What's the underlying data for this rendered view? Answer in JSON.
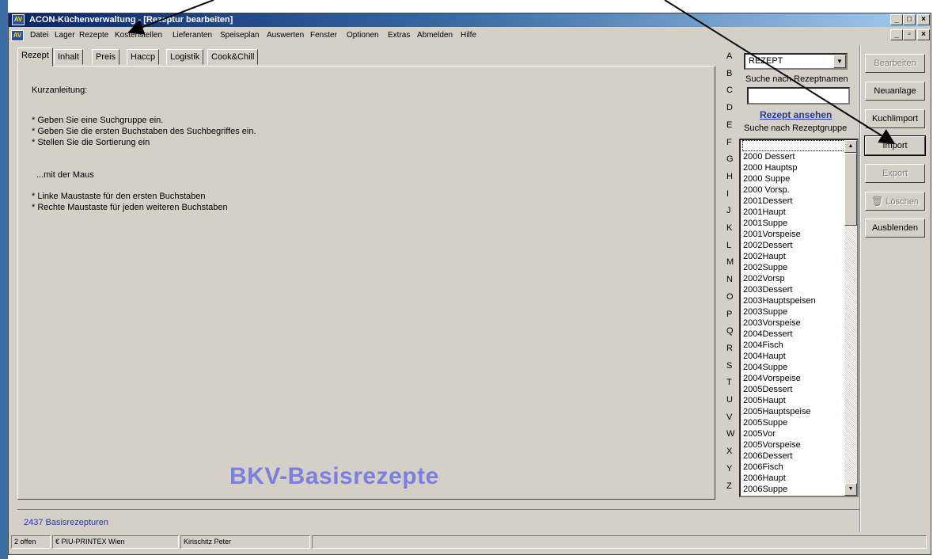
{
  "window": {
    "title": "ACON-Küchenverwaltung - [Rezeptur bearbeiten]",
    "icon_label": "AV"
  },
  "menu": [
    "Datei",
    "Lager",
    "Rezepte",
    "Kostenstellen",
    "Lieferanten",
    "Speiseplan",
    "Auswerten",
    "Fenster",
    "Optionen",
    "Extras",
    "Abmelden",
    "Hilfe"
  ],
  "tabs": [
    "Rezept",
    "Inhalt",
    "Preis",
    "Haccp",
    "Logistik",
    "Cook&Chill"
  ],
  "instructions": {
    "heading": "Kurzanleitung:",
    "line1": "* Geben Sie eine Suchgruppe ein.",
    "line2": "* Geben Sie die ersten Buchstaben des Suchbegriffes ein.",
    "line3": "* Stellen Sie die Sortierung ein",
    "mouse": "...mit der Maus",
    "line4": "* Linke Maustaste für den ersten Buchstaben",
    "line5": "* Rechte Maustaste für jeden weiteren Buchstaben"
  },
  "watermark": "BKV-Basisrezepte",
  "letters": [
    "A",
    "B",
    "C",
    "D",
    "E",
    "F",
    "G",
    "H",
    "I",
    "J",
    "K",
    "L",
    "M",
    "N",
    "O",
    "P",
    "Q",
    "R",
    "S",
    "T",
    "U",
    "V",
    "W",
    "X",
    "Y",
    "Z"
  ],
  "search": {
    "group_value": "REZEPT",
    "name_label": "Suche nach Rezeptnamen",
    "name_value": "",
    "view_link": "Rezept ansehen",
    "group_label": "Suche nach Rezeptgruppe"
  },
  "groups": [
    "",
    "2000 Dessert",
    "2000 Hauptsp",
    "2000 Suppe",
    "2000 Vorsp.",
    "2001Dessert",
    "2001Haupt",
    "2001Suppe",
    "2001Vorspeise",
    "2002Dessert",
    "2002Haupt",
    "2002Suppe",
    "2002Vorsp",
    "2003Dessert",
    "2003Hauptspeisen",
    "2003Suppe",
    "2003Vorspeise",
    "2004Dessert",
    "2004Fisch",
    "2004Haupt",
    "2004Suppe",
    "2004Vorspeise",
    "2005Dessert",
    "2005Haupt",
    "2005Hauptspeise",
    "2005Suppe",
    "2005Vor",
    "2005Vorspeise",
    "2006Dessert",
    "2006Fisch",
    "2006Haupt",
    "2006Suppe"
  ],
  "buttons": {
    "bearbeiten": "Bearbeiten",
    "neuanlage": "Neuanlage",
    "kuchlimport": "Kuchlimport",
    "import": "Import",
    "export": "Export",
    "loeschen": "Löschen",
    "ausblenden": "Ausblenden"
  },
  "count_label": "2437 Basisrezepturen",
  "statusbar": [
    "2 offen",
    "€ PIU-PRINTEX Wien",
    "Kirischitz Peter",
    ""
  ]
}
